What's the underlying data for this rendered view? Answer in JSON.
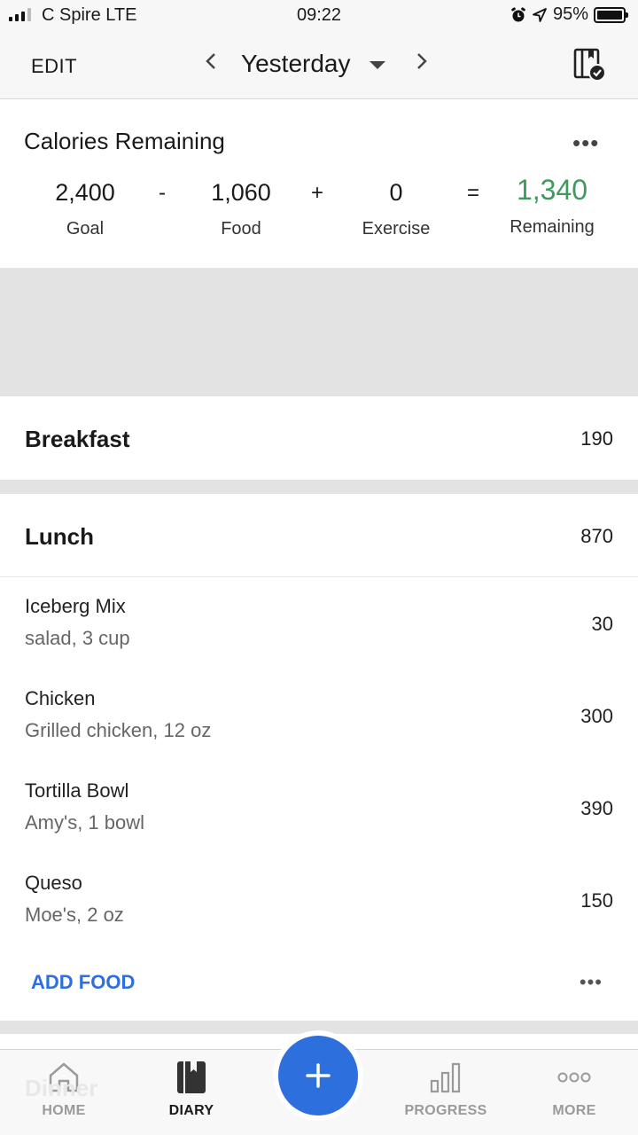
{
  "status_bar": {
    "carrier": "C Spire  LTE",
    "time": "09:22",
    "battery": "95%"
  },
  "nav": {
    "edit_label": "EDIT",
    "day_label": "Yesterday"
  },
  "calories": {
    "title": "Calories Remaining",
    "goal_value": "2,400",
    "goal_label": "Goal",
    "minus": "-",
    "food_value": "1,060",
    "food_label": "Food",
    "plus": "+",
    "exercise_value": "0",
    "exercise_label": "Exercise",
    "equals": "=",
    "remaining_value": "1,340",
    "remaining_label": "Remaining",
    "remaining_color": "#3e9a5c"
  },
  "breakfast": {
    "name": "Breakfast",
    "calories": "190"
  },
  "lunch": {
    "name": "Lunch",
    "calories": "870",
    "items": [
      {
        "name": "Iceberg Mix",
        "desc": "salad, 3 cup",
        "calories": "30"
      },
      {
        "name": "Chicken",
        "desc": "Grilled chicken, 12 oz",
        "calories": "300"
      },
      {
        "name": "Tortilla Bowl",
        "desc": "Amy's, 1 bowl",
        "calories": "390"
      },
      {
        "name": "Queso",
        "desc": "Moe's, 2 oz",
        "calories": "150"
      }
    ],
    "add_food_label": "ADD FOOD"
  },
  "dinner": {
    "name": "Dinner"
  },
  "tabs": {
    "home": "HOME",
    "diary": "DIARY",
    "progress": "PROGRESS",
    "more": "MORE"
  },
  "accent_color": "#2d6fdc"
}
